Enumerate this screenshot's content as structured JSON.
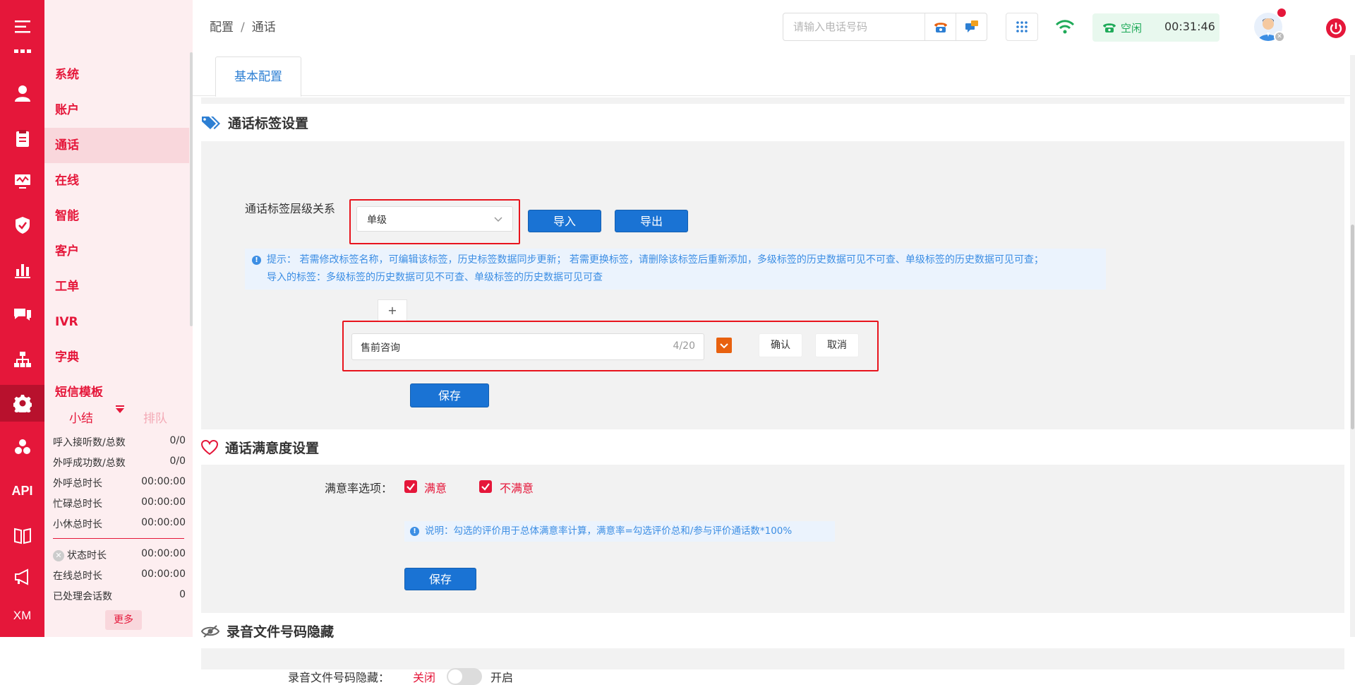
{
  "rail": {
    "items": [
      "menu-icon",
      "user-icon",
      "clipboard-icon",
      "monitor-icon",
      "shield-icon",
      "chart-icon",
      "chat-icon",
      "org-icon",
      "gear-icon",
      "cubes-icon",
      "API",
      "book-icon",
      "megaphone-icon",
      "XM"
    ],
    "api_label": "API",
    "xm_label": "XM"
  },
  "sidebar": {
    "items": [
      {
        "label": "系统"
      },
      {
        "label": "账户"
      },
      {
        "label": "通话"
      },
      {
        "label": "在线"
      },
      {
        "label": "智能"
      },
      {
        "label": "客户"
      },
      {
        "label": "工单"
      },
      {
        "label": "IVR"
      },
      {
        "label": "字典"
      },
      {
        "label": "短信模板"
      }
    ]
  },
  "stats": {
    "tab_summary": "小结",
    "tab_queue": "排队",
    "rows": [
      {
        "label": "呼入接听数/总数",
        "value": "0/0"
      },
      {
        "label": "外呼成功数/总数",
        "value": "0/0"
      },
      {
        "label": "外呼总时长",
        "value": "00:00:00"
      },
      {
        "label": "忙碌总时长",
        "value": "00:00:00"
      },
      {
        "label": "小休总时长",
        "value": "00:00:00"
      }
    ],
    "rows2": [
      {
        "label": "状态时长",
        "value": "00:00:00"
      },
      {
        "label": "在线总时长",
        "value": "00:00:00"
      },
      {
        "label": "已处理会话数",
        "value": "0"
      }
    ],
    "more": "更多"
  },
  "header": {
    "breadcrumb_1": "配置",
    "breadcrumb_sep": "/",
    "breadcrumb_2": "通话",
    "search_placeholder": "请输入电话号码",
    "status_label": "空闲",
    "timer": "00:31:46"
  },
  "tabs": {
    "basic": "基本配置"
  },
  "tag_section": {
    "title": "通话标签设置",
    "hierarchy_label": "通话标签层级关系",
    "hierarchy_value": "单级",
    "import": "导入",
    "export": "导出",
    "tip_line1": "提示： 若需修改标签名称，可编辑该标签，历史标签数据同步更新； 若需更换标签，请删除该标签后重新添加，多级标签的历史数据可见不可查、单级标签的历史数据可见可查；",
    "tip_line2": "导入的标签：多级标签的历史数据可见不可查、单级标签的历史数据可见可查",
    "plus": "+",
    "tag_value": "售前咨询",
    "tag_count": "4/20",
    "confirm": "确认",
    "cancel": "取消",
    "save": "保存"
  },
  "satisfaction_section": {
    "title": "通话满意度设置",
    "options_label": "满意率选项：",
    "opt1": "满意",
    "opt2": "不满意",
    "note": "说明：勾选的评价用于总体满意率计算，满意率=勾选评价总和/参与评价通话数*100%",
    "save": "保存"
  },
  "recording_section": {
    "title": "录音文件号码隐藏",
    "label": "录音文件号码隐藏：",
    "off": "关闭",
    "on": "开启"
  },
  "colors": {
    "brand_red": "#e5173a",
    "primary_blue": "#1a73d4",
    "tip_blue": "#3c8ee4",
    "status_green": "#1faa59"
  }
}
